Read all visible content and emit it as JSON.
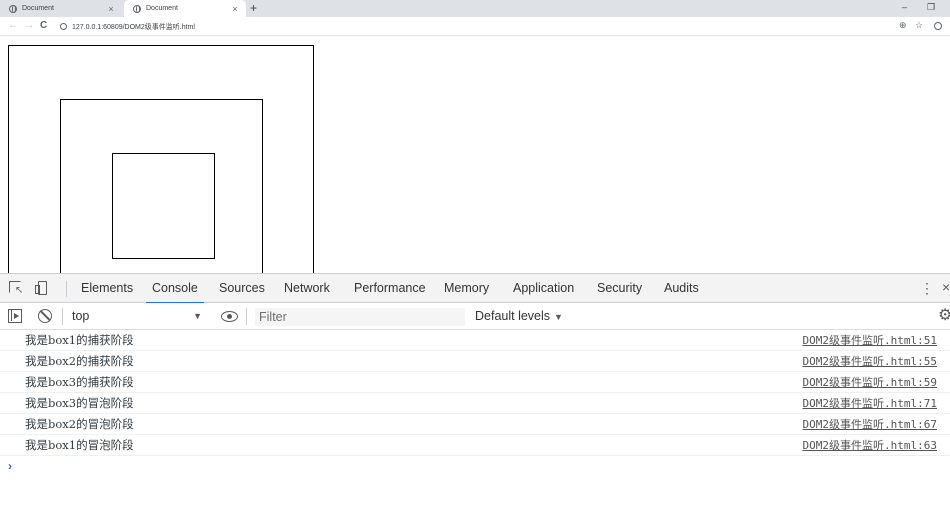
{
  "browser": {
    "tabs": [
      {
        "title": "Document",
        "active": false
      },
      {
        "title": "Document",
        "active": true
      }
    ],
    "new_tab_label": "+",
    "url": "127.0.0.1:60809/DOM2级事件监听.html",
    "icons": {
      "back": "←",
      "forward": "→",
      "reload": "C",
      "zoom": "⊕",
      "star": "☆",
      "tab_close": "×",
      "minimize": "–",
      "maximize": "❐"
    }
  },
  "page": {
    "boxes": [
      "box1",
      "box2",
      "box3"
    ]
  },
  "devtools": {
    "tabs": [
      "Elements",
      "Console",
      "Sources",
      "Network",
      "Performance",
      "Memory",
      "Application",
      "Security",
      "Audits"
    ],
    "active_tab": "Console",
    "context": "top",
    "filter_placeholder": "Filter",
    "levels_label": "Default levels",
    "caret": "▼",
    "close_glyph": "×",
    "kebab_glyph": "⋮",
    "settings_glyph": "⚙",
    "prompt_glyph": "›",
    "logs": [
      {
        "message": "我是box1的捕获阶段",
        "source": "DOM2级事件监听.html:51"
      },
      {
        "message": "我是box2的捕获阶段",
        "source": "DOM2级事件监听.html:55"
      },
      {
        "message": "我是box3的捕获阶段",
        "source": "DOM2级事件监听.html:59"
      },
      {
        "message": "我是box3的冒泡阶段",
        "source": "DOM2级事件监听.html:71"
      },
      {
        "message": "我是box2的冒泡阶段",
        "source": "DOM2级事件监听.html:67"
      },
      {
        "message": "我是box1的冒泡阶段",
        "source": "DOM2级事件监听.html:63"
      }
    ]
  }
}
